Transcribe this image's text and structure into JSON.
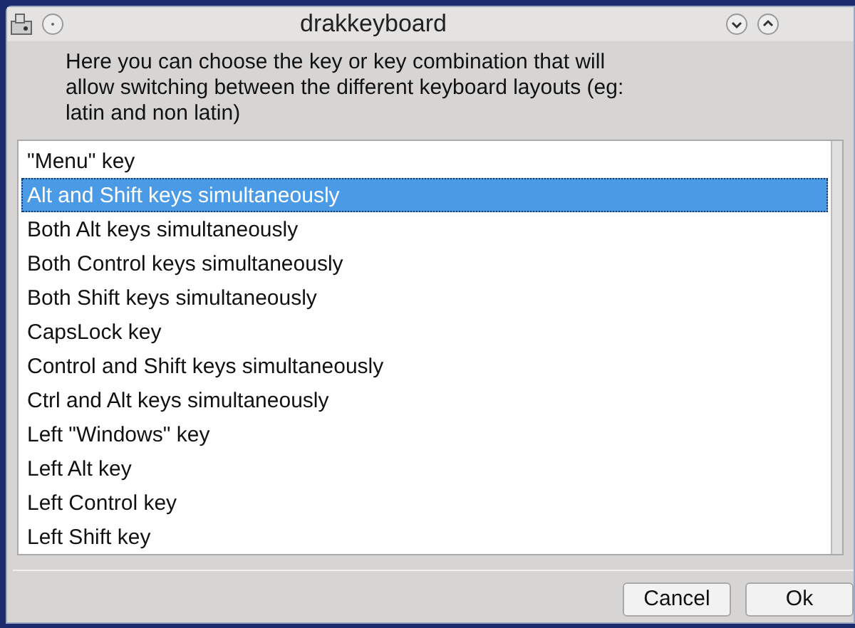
{
  "window": {
    "title": "drakkeyboard"
  },
  "description": "Here you can choose the key or key combination that will allow switching between the different keyboard layouts (eg: latin and non latin)",
  "options": [
    {
      "label": "\"Menu\" key",
      "selected": false
    },
    {
      "label": "Alt and Shift keys simultaneously",
      "selected": true
    },
    {
      "label": "Both Alt keys simultaneously",
      "selected": false
    },
    {
      "label": "Both Control keys simultaneously",
      "selected": false
    },
    {
      "label": "Both Shift keys simultaneously",
      "selected": false
    },
    {
      "label": "CapsLock key",
      "selected": false
    },
    {
      "label": "Control and Shift keys simultaneously",
      "selected": false
    },
    {
      "label": "Ctrl and Alt keys simultaneously",
      "selected": false
    },
    {
      "label": "Left \"Windows\" key",
      "selected": false
    },
    {
      "label": "Left Alt key",
      "selected": false
    },
    {
      "label": "Left Control key",
      "selected": false
    },
    {
      "label": "Left Shift key",
      "selected": false
    }
  ],
  "buttons": [
    "Cancel",
    "Ok"
  ]
}
